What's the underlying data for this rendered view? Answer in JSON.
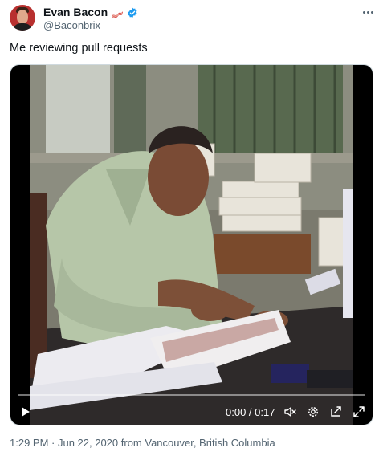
{
  "user": {
    "display_name": "Evan Bacon",
    "emoji_icon": "bacon-icon",
    "verified_icon": "verified-badge-icon",
    "handle": "@Baconbrix",
    "avatar_icon": "avatar"
  },
  "tweet": {
    "text": "Me reviewing pull requests"
  },
  "video": {
    "time": "0:00 / 0:17",
    "progress": 0,
    "controls": [
      "play-icon",
      "mute-icon",
      "settings-icon",
      "pip-icon",
      "fullscreen-icon"
    ]
  },
  "footer": {
    "meta": "1:29 PM · Jun 22, 2020 from Vancouver, British Columbia"
  },
  "colors": {
    "verified": "#1d9bf0",
    "secondary_text": "#536471",
    "primary_text": "#0f1419"
  }
}
